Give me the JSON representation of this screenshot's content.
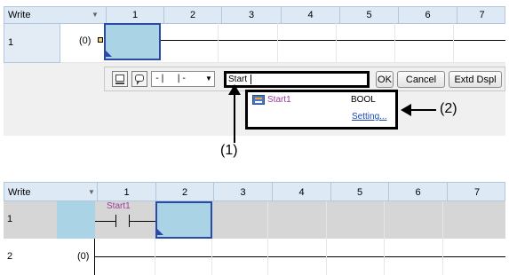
{
  "before": {
    "header": {
      "write_label": "Write",
      "col_nums": [
        "1",
        "2",
        "3",
        "4",
        "5",
        "6",
        "7"
      ]
    },
    "row1_label": "1",
    "coil_label": "(0)",
    "toolbar": {
      "instr_select": "-|  |-",
      "input_value": "Start",
      "ok_label": "OK",
      "cancel_label": "Cancel",
      "extd_label": "Extd Dspl"
    },
    "suggestion": {
      "name": "Start1",
      "type": "BOOL",
      "setting_link": "Setting..."
    },
    "callout1": "(1)",
    "callout2": "(2)"
  },
  "after": {
    "header": {
      "write_label": "Write",
      "col_nums": [
        "1",
        "2",
        "3",
        "4",
        "5",
        "6",
        "7"
      ]
    },
    "row1_label": "1",
    "row2_label": "2",
    "contact_label": "Start1",
    "coil_label": "(0)"
  },
  "colors": {
    "header_bg": "#dde9f5",
    "selected_cell": "#aad4e6",
    "selected_border": "#2a4aa6",
    "device_text": "#9b3d9b",
    "link": "#1a48b0"
  },
  "icons": [
    "dropdown-arrow-icon",
    "ladder-coil-icon",
    "monitor-icon",
    "comment-icon",
    "label-variable-icon",
    "arrow-up-icon",
    "arrow-left-icon"
  ]
}
